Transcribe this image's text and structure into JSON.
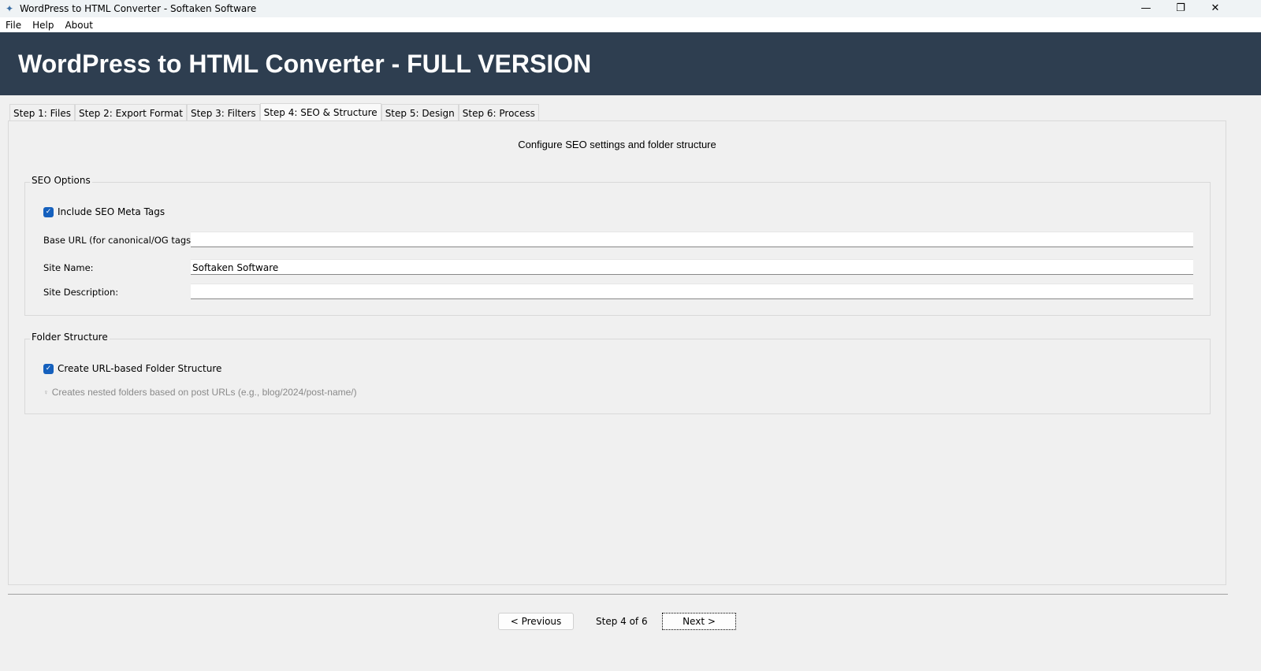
{
  "window": {
    "title": "WordPress to HTML Converter - Softaken Software",
    "minimize": "—",
    "maximize": "❐",
    "close": "✕"
  },
  "menu": [
    "File",
    "Help",
    "About"
  ],
  "header": {
    "title": "WordPress to HTML Converter - FULL VERSION",
    "bg": "#2e3e50"
  },
  "tabs": [
    "Step 1: Files",
    "Step 2: Export Format",
    "Step 3: Filters",
    "Step 4: SEO & Structure",
    "Step 5: Design",
    "Step 6: Process"
  ],
  "active_tab": 3,
  "page": {
    "subtitle": "Configure SEO settings and folder structure"
  },
  "seo": {
    "legend": "SEO Options",
    "include_meta": {
      "label": "Include SEO Meta Tags",
      "checked": true
    },
    "base_url": {
      "label": "Base URL (for canonical/OG tags):",
      "value": ""
    },
    "site_name": {
      "label": "Site Name:",
      "value": "Softaken Software"
    },
    "site_description": {
      "label": "Site Description:",
      "value": ""
    }
  },
  "folder": {
    "legend": "Folder Structure",
    "url_folders": {
      "label": "Create URL-based Folder Structure",
      "checked": true
    },
    "hint": "Creates nested folders based on post URLs (e.g., blog/2024/post-name/)",
    "hint_icon": "lightbulb-icon"
  },
  "nav": {
    "previous": "< Previous",
    "step": "Step 4 of 6",
    "next": "Next >"
  }
}
